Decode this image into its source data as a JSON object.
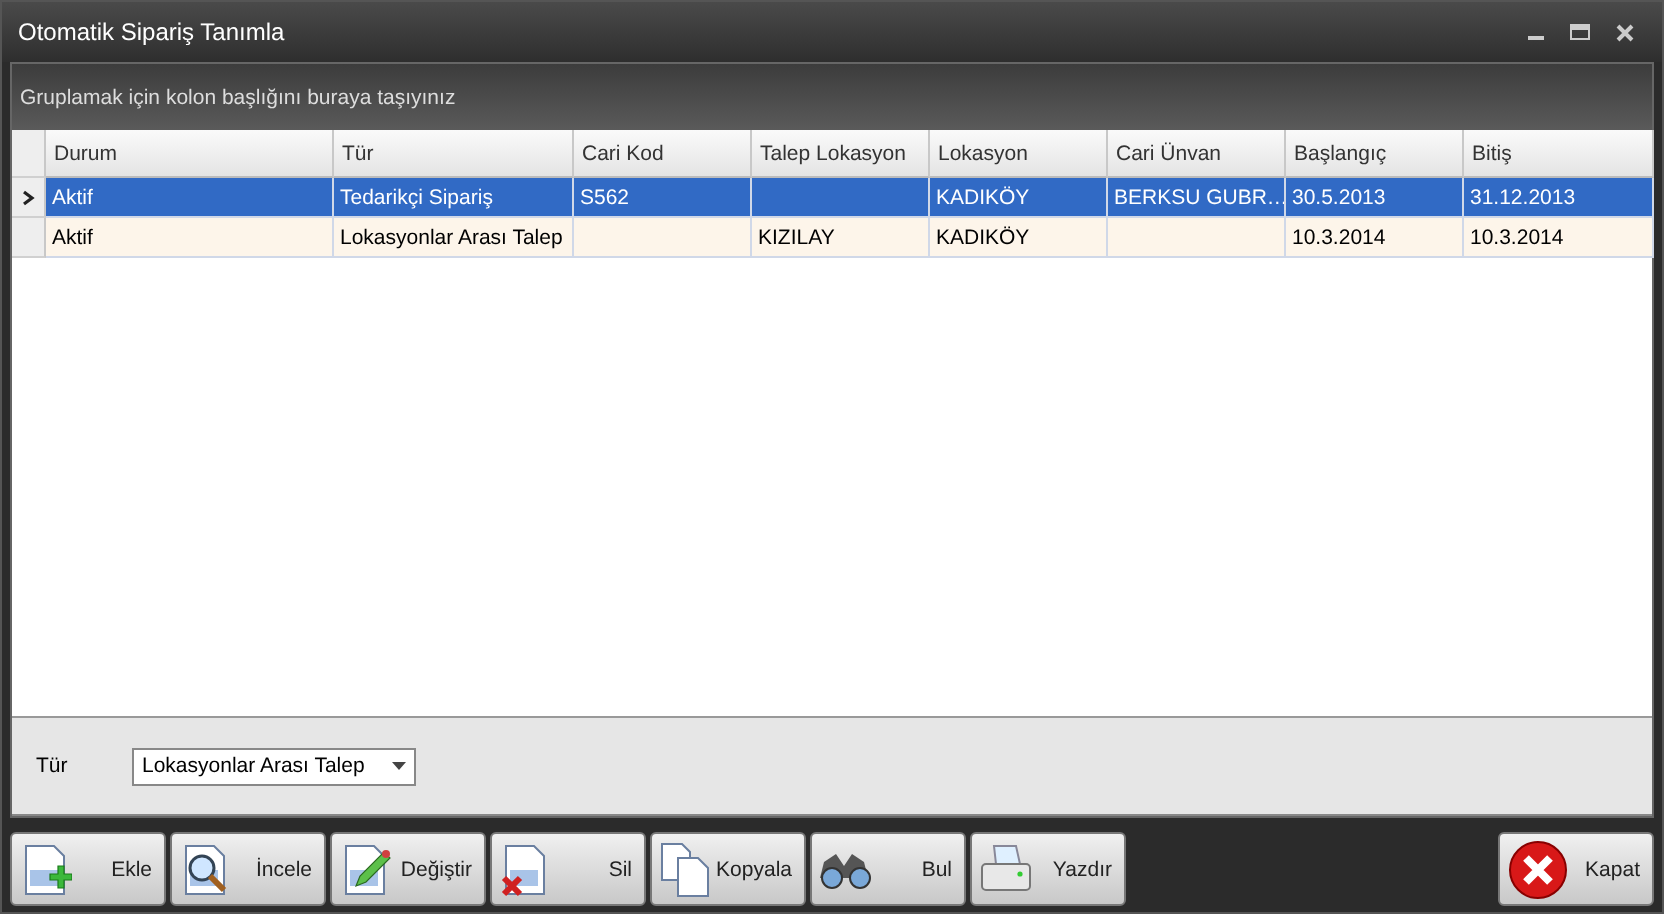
{
  "window": {
    "title": "Otomatik Sipariş Tanımla"
  },
  "group_panel": {
    "hint": "Gruplamak için kolon başlığını buraya taşıyınız"
  },
  "table": {
    "columns": [
      "Durum",
      "Tür",
      "Cari Kod",
      "Talep Lokasyon",
      "Lokasyon",
      "Cari Ünvan",
      "Başlangıç",
      "Bitiş"
    ],
    "rows": [
      {
        "selected": true,
        "cells": [
          "Aktif",
          "Tedarikçi Sipariş",
          "S562",
          "",
          "KADIKÖY",
          "BERKSU GUBR…",
          "30.5.2013",
          "31.12.2013"
        ]
      },
      {
        "selected": false,
        "cells": [
          "Aktif",
          "Lokasyonlar Arası Talep",
          "",
          "KIZILAY",
          "KADIKÖY",
          "",
          "10.3.2014",
          "10.3.2014"
        ]
      }
    ]
  },
  "filter": {
    "label": "Tür",
    "value": "Lokasyonlar Arası Talep"
  },
  "buttons": [
    {
      "kind": "add",
      "label": "Ekle"
    },
    {
      "kind": "inspect",
      "label": "İncele"
    },
    {
      "kind": "edit",
      "label": "Değiştir"
    },
    {
      "kind": "delete",
      "label": "Sil"
    },
    {
      "kind": "copy",
      "label": "Kopyala"
    },
    {
      "kind": "find",
      "label": "Bul"
    },
    {
      "kind": "print",
      "label": "Yazdır"
    },
    {
      "kind": "close",
      "label": "Kapat"
    }
  ]
}
